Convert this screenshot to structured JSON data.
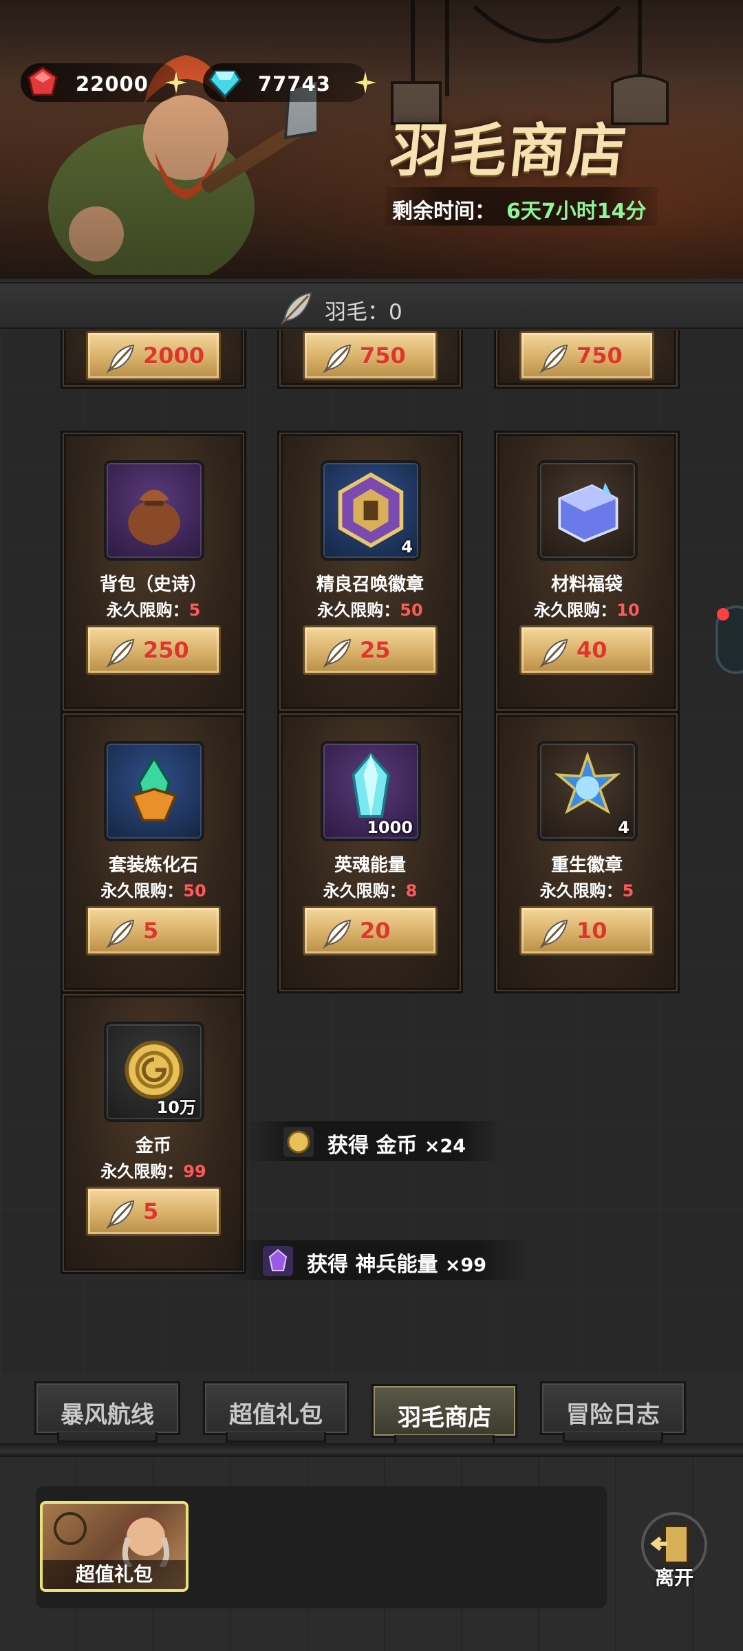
{
  "header": {
    "ruby_amount": "22000",
    "gem_amount": "77743",
    "shop_title": "羽毛商店",
    "timer_label": "剩余时间：",
    "timer_value": "6天7小时14分"
  },
  "feather_balance": "羽毛：0",
  "partial_row": [
    {
      "price": "2000"
    },
    {
      "price": "750"
    },
    {
      "price": "750"
    }
  ],
  "items": [
    {
      "name": "背包（史诗）",
      "limit_label": "永久限购：",
      "limit": "5",
      "price": "250",
      "qty": "",
      "icon": "bag-icon"
    },
    {
      "name": "精良召唤徽章",
      "limit_label": "永久限购：",
      "limit": "50",
      "price": "25",
      "qty": "4",
      "icon": "summon-badge-icon"
    },
    {
      "name": "材料福袋",
      "limit_label": "永久限购：",
      "limit": "10",
      "price": "40",
      "qty": "",
      "icon": "material-chest-icon"
    },
    {
      "name": "套装炼化石",
      "limit_label": "永久限购：",
      "limit": "50",
      "price": "5",
      "qty": "",
      "icon": "refining-stone-icon"
    },
    {
      "name": "英魂能量",
      "limit_label": "永久限购：",
      "limit": "8",
      "price": "20",
      "qty": "1000",
      "icon": "soul-crystal-icon"
    },
    {
      "name": "重生徽章",
      "limit_label": "永久限购：",
      "limit": "5",
      "price": "10",
      "qty": "4",
      "icon": "rebirth-badge-icon"
    },
    {
      "name": "金币",
      "limit_label": "永久限购：",
      "limit": "99",
      "price": "5",
      "qty": "10万",
      "icon": "gold-coin-icon"
    }
  ],
  "toasts": [
    {
      "text": "获得 金币 ",
      "mult": "×24"
    },
    {
      "text": "获得 神兵能量 ",
      "mult": "×99"
    }
  ],
  "tabs": [
    "暴风航线",
    "超值礼包",
    "羽毛商店",
    "冒险日志"
  ],
  "active_tab": "羽毛商店",
  "bottom": {
    "pack_label": "超值礼包",
    "leave_label": "离开"
  },
  "colors": {
    "accent_gold": "#d8b068",
    "price_red": "#e0352a",
    "timer_green": "#8ef59b"
  }
}
